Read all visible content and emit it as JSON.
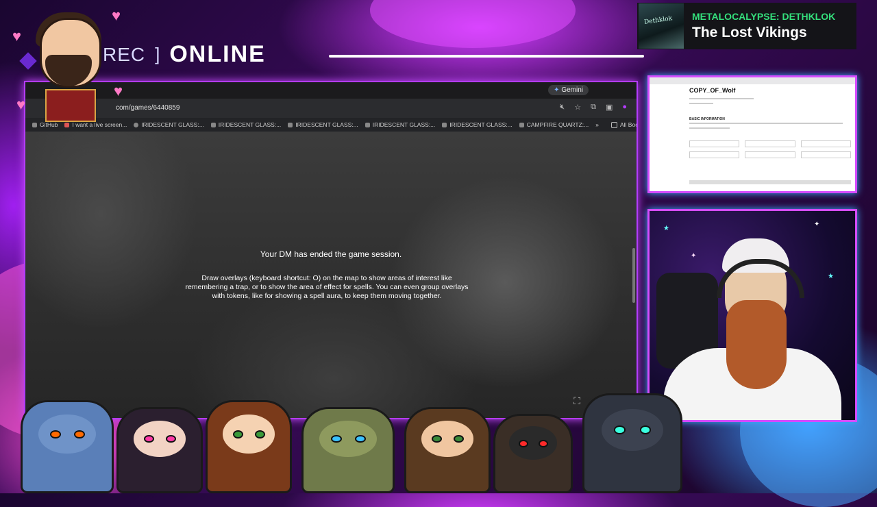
{
  "overlay": {
    "rec_label": "REC",
    "status_label": "ONLINE"
  },
  "now_playing": {
    "artist": "METALOCALYPSE: DETHKLOK",
    "track": "The Lost Vikings",
    "album_art_text": "Dethklok"
  },
  "browser": {
    "gemini_label": "Gemini",
    "url": "com/games/6440859",
    "bookmarks": [
      "GitHub",
      "I want a live screen...",
      "IRIDESCENT GLASS:...",
      "IRIDESCENT GLASS:...",
      "IRIDESCENT GLASS:...",
      "IRIDESCENT GLASS:...",
      "IRIDESCENT GLASS:...",
      "CAMPFIRE QUARTZ:..."
    ],
    "all_bookmarks": "All Bookmarks",
    "more_bookmarks_glyph": "»"
  },
  "game": {
    "session_message": "Your DM has ended the game session.",
    "tip_message": "Draw overlays (keyboard shortcut: O) on the map to show areas of interest like remembering a trap, or to show the area of effect for spells. You can even group overlays with tokens, like for showing a spell aura, to keep them moving together."
  },
  "doc_preview": {
    "title": "COPY_OF_Wolf",
    "section": "BASIC INFORMATION"
  },
  "colors": {
    "accent_pink": "#d44cff",
    "accent_blue": "#3fa8ff",
    "now_playing_green": "#34e07c"
  }
}
